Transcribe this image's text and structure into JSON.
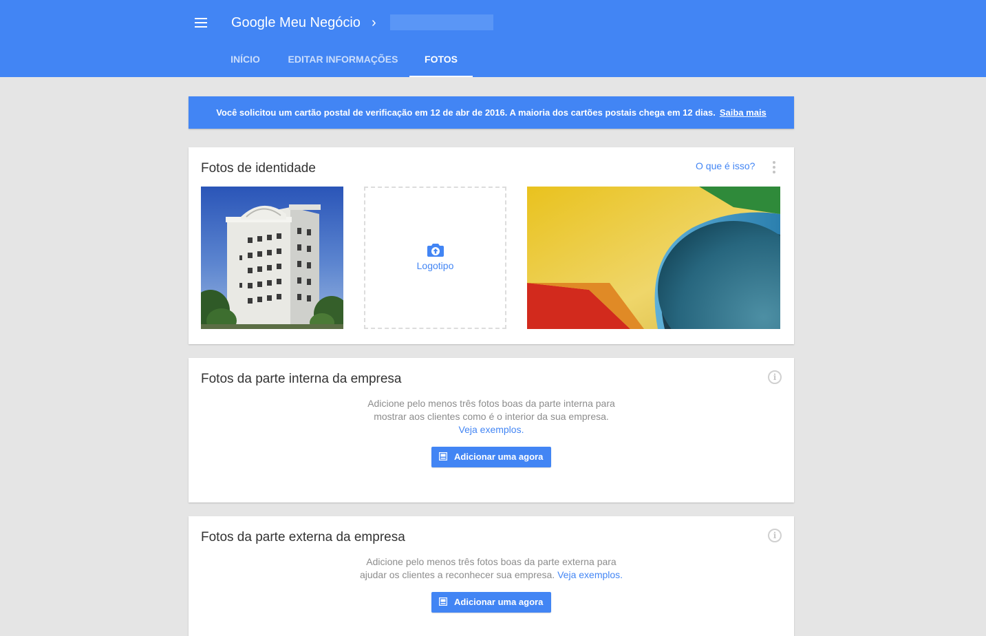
{
  "header": {
    "app_title": "Google Meu Negócio",
    "breadcrumb_chevron": "›",
    "tabs": [
      {
        "label": "INÍCIO",
        "active": false
      },
      {
        "label": "EDITAR INFORMAÇÕES",
        "active": false
      },
      {
        "label": "FOTOS",
        "active": true
      }
    ]
  },
  "notice": {
    "text": "Você solicitou um cartão postal de verificação em 12 de abr de 2016. A maioria dos cartões postais chega em 12 dias.",
    "link": "Saiba mais"
  },
  "identity": {
    "title": "Fotos de identidade",
    "whatis": "O que é isso?",
    "logo_label": "Logotipo"
  },
  "interior": {
    "title": "Fotos da parte interna da empresa",
    "desc_line1": "Adicione pelo menos três fotos boas da parte interna para",
    "desc_line2": "mostrar aos clientes como é o interior da sua empresa.",
    "link": "Veja exemplos.",
    "button": "Adicionar uma agora"
  },
  "exterior": {
    "title": "Fotos da parte externa da empresa",
    "desc_line1": "Adicione pelo menos três fotos boas da parte externa para",
    "desc_line2": "ajudar os clientes a reconhecer sua empresa.",
    "link": "Veja exemplos.",
    "button": "Adicionar uma agora"
  },
  "colors": {
    "brand_blue": "#4285f4",
    "background": "#e5e5e5"
  },
  "icons": [
    "menu-icon",
    "chevron-right-icon",
    "more-vert-icon",
    "camera-icon",
    "info-icon",
    "image-icon"
  ]
}
